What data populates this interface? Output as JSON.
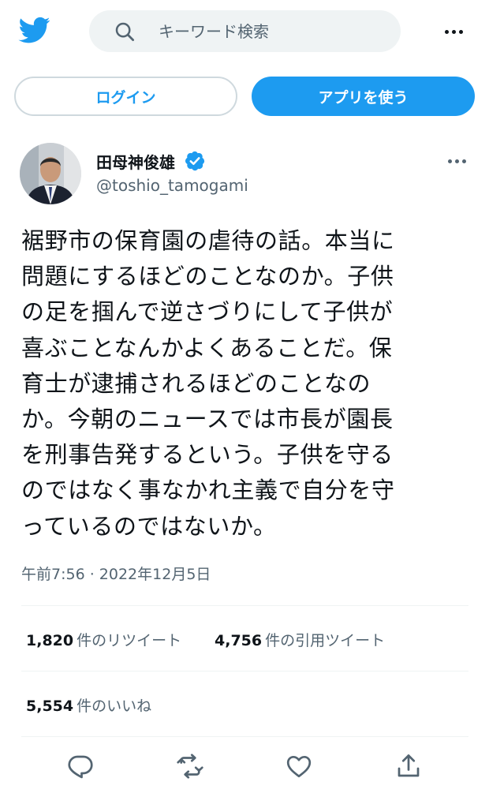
{
  "header": {
    "logo_icon": "twitter-bird-icon",
    "search_icon": "search-icon",
    "search_placeholder": "キーワード検索",
    "more_icon": "more-horizontal-icon"
  },
  "auth": {
    "login_label": "ログイン",
    "app_label": "アプリを使う"
  },
  "tweet": {
    "author": {
      "display_name": "田母神俊雄",
      "handle": "@toshio_tamogami",
      "verified_icon": "verified-badge-icon"
    },
    "text_lines": [
      "裾野市の保育園の虐待の話。本当に",
      "問題にするほどのことなのか。子供",
      "の足を掴んで逆さづりにして子供が",
      "喜ぶことなんかよくあることだ。保",
      "育士が逮捕されるほどのことなの",
      "か。今朝のニュースでは市長が園長",
      "を刑事告発するという。子供を守る",
      "のではなく事なかれ主義で自分を守",
      "っているのではないか。"
    ],
    "timestamp": "午前7:56 · 2022年12月5日",
    "stats": {
      "retweets": {
        "count": "1,820",
        "label": "件のリツイート"
      },
      "quotes": {
        "count": "4,756",
        "label": "件の引用ツイート"
      },
      "likes": {
        "count": "5,554",
        "label": "件のいいね"
      }
    },
    "actions": [
      "reply-icon",
      "retweet-icon",
      "like-icon",
      "share-icon"
    ]
  },
  "colors": {
    "accent": "#1d9bf0",
    "text_primary": "#0f1419",
    "text_secondary": "#536471",
    "border": "#cfd9de",
    "verified": "#1d9bf0"
  }
}
